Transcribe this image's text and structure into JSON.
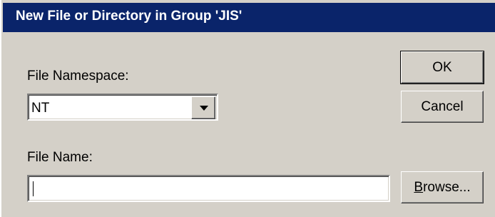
{
  "dialog": {
    "title": "New File or Directory in Group 'JIS'"
  },
  "namespace": {
    "label": "File Namespace:",
    "selected": "NT"
  },
  "filename": {
    "label": "File Name:",
    "value": ""
  },
  "buttons": {
    "ok": "OK",
    "cancel": "Cancel",
    "browse": "Browse..."
  },
  "icons": {
    "dropdown": "chevron-down-icon"
  },
  "colors": {
    "titlebar": "#0a246a",
    "face": "#d4d0c8"
  }
}
